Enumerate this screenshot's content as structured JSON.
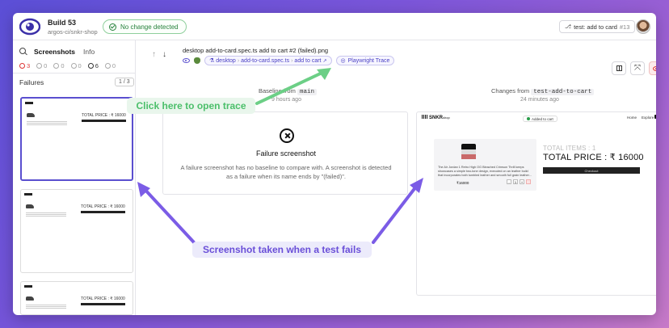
{
  "header": {
    "build_title": "Build 53",
    "build_sub": "argos-ci/snkr-shop",
    "status": "No change detected",
    "test_label": "test: add to card",
    "test_num": "#13"
  },
  "sidebar": {
    "tab_screenshots": "Screenshots",
    "tab_info": "Info",
    "counts": [
      "3",
      "0",
      "0",
      "0",
      "6",
      "0"
    ],
    "failures_label": "Failures",
    "failures_pager": "1 / 3",
    "thumb_total": "TOTAL PRICE : ₹ 16000"
  },
  "main": {
    "file_title": "desktop add-to-card.spec.ts add to cart #2 (failed).png",
    "path_chip": [
      "desktop",
      "add-to-card.spec.ts",
      "add to cart"
    ],
    "trace_chip": "Playwright Trace",
    "baseline_prefix": "Baseline from",
    "baseline_branch": "main",
    "baseline_time": "9 hours ago",
    "changes_prefix": "Changes from",
    "changes_branch": "test-add-to-cart",
    "changes_time": "24 minutes ago",
    "fail_title": "Failure screenshot",
    "fail_desc": "A failure screenshot has no baseline to compare with. A screenshot is detected as a failure when its name ends by \"(failed)\"."
  },
  "preview": {
    "brand": "SNKR",
    "brand_suffix": "shop",
    "toast": "Added to cart",
    "nav": [
      "Home",
      "Explore"
    ],
    "product_text": "The Air Jordan 1 Retro High OG Bleached Crimson Thrill keeps showcases a simple two-tone design, executed on an leather build that incorporates both tumbled leather and smooth full grain leather...",
    "price": "₹16000",
    "qty": [
      "-",
      "1",
      "+"
    ],
    "total_items": "TOTAL ITEMS : 1",
    "total_price": "TOTAL PRICE : ₹ 16000",
    "checkout": "Checkout"
  },
  "annotations": {
    "trace_callout": "Click here to open trace",
    "fail_callout": "Screenshot taken when a test fails",
    "trace_color": "#4bbf6a",
    "fail_color": "#6a4fd8"
  }
}
